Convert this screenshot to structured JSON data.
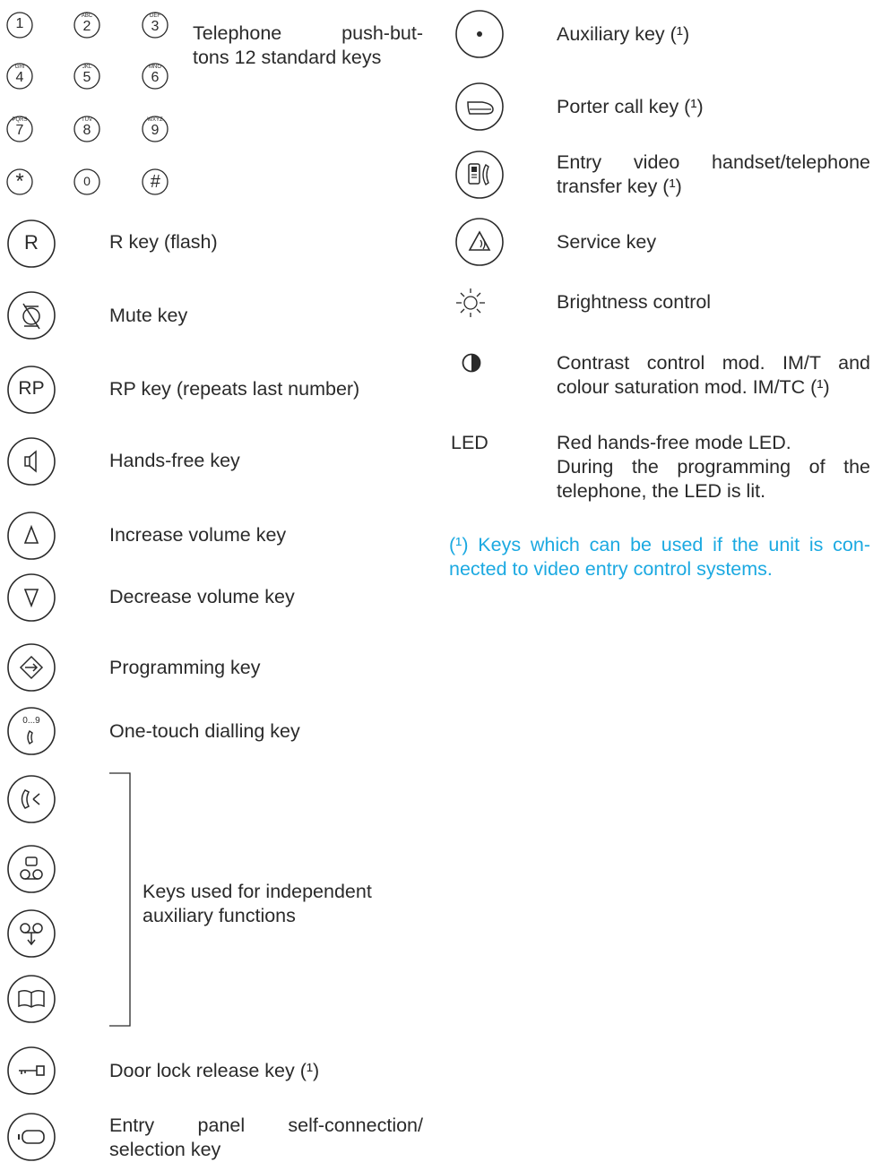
{
  "keypad": {
    "keys": [
      {
        "digit": "1",
        "letters": ""
      },
      {
        "digit": "2",
        "letters": "ABC"
      },
      {
        "digit": "3",
        "letters": "DEF"
      },
      {
        "digit": "4",
        "letters": "GHI"
      },
      {
        "digit": "5",
        "letters": "JKL"
      },
      {
        "digit": "6",
        "letters": "MNO"
      },
      {
        "digit": "7",
        "letters": "PQRS"
      },
      {
        "digit": "8",
        "letters": "TUV"
      },
      {
        "digit": "9",
        "letters": "WXYZ"
      },
      {
        "digit": "*",
        "letters": ""
      },
      {
        "digit": "0",
        "letters": ""
      },
      {
        "digit": "#",
        "letters": ""
      }
    ],
    "desc_line1": "Telephone push-but-",
    "desc_line2": "tons 12 standard keys"
  },
  "left_items": {
    "r_key": {
      "glyph": "R",
      "label": "R key (flash)"
    },
    "mute_key": {
      "label": "Mute key"
    },
    "rp_key": {
      "glyph": "RP",
      "label": "RP key (repeats last number)"
    },
    "handsfree_key": {
      "label": "Hands-free key"
    },
    "increase_volume_key": {
      "label": "Increase volume key"
    },
    "decrease_volume_key": {
      "label": "Decrease volume key"
    },
    "programming_key": {
      "label": "Programming key"
    },
    "one_touch_key": {
      "glyph": "0...9",
      "label": "One-touch dialling key"
    },
    "aux_group_line1": "Keys used for independent",
    "aux_group_line2": "auxiliary functions",
    "door_lock_key": {
      "label": "Door lock release key (¹)"
    },
    "entry_panel_key": {
      "label_line1": "Entry panel self-connection/",
      "label_line2": "selection key"
    }
  },
  "right_items": {
    "auxiliary_key": {
      "label": "Auxiliary key (¹)"
    },
    "porter_call_key": {
      "label": "Porter call key (¹)"
    },
    "transfer_key": {
      "label_line1": "Entry video handset/telephone",
      "label_line2": "transfer key (¹)"
    },
    "service_key": {
      "label": "Service key"
    },
    "brightness": {
      "label": "Brightness control"
    },
    "contrast": {
      "label_line1": "Contrast control mod. IM/T and",
      "label_line2": "colour saturation mod. IM/TC (¹)"
    },
    "led": {
      "tag": "LED",
      "line1": "Red hands-free mode LED.",
      "line2": "During the programming of the",
      "line3": "telephone, the LED is lit."
    },
    "footnote": {
      "line1": "(¹) Keys which can be used if the unit is con-",
      "line2": "nected to video entry control systems."
    }
  },
  "colors": {
    "text": "#2a2a2a",
    "footnote": "#1ba9e1"
  }
}
